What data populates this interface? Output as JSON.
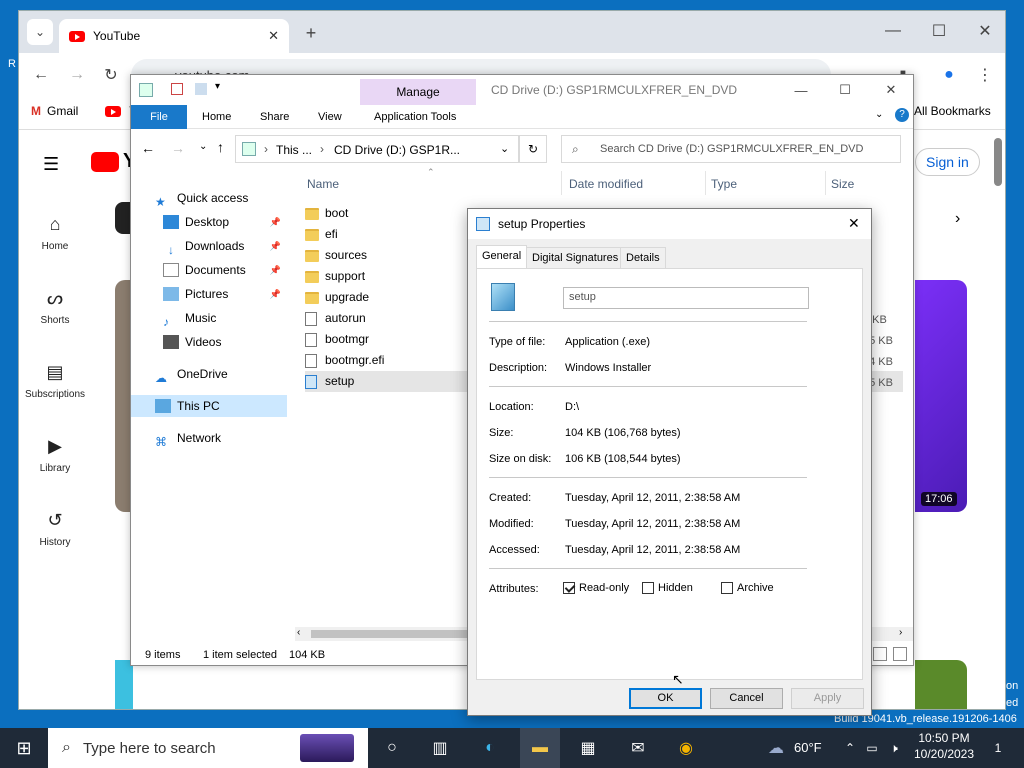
{
  "desktop": {
    "left_text": "R",
    "right_text_1": "on",
    "right_text_2": "ed",
    "build": "Build 19041.vb_release.191206-1406"
  },
  "chrome": {
    "tab_title": "YouTube",
    "tab_close": "✕",
    "new_tab": "+",
    "url": "youtube.com",
    "bookmarks": [
      {
        "label": "Gmail"
      },
      {
        "label": "Y"
      }
    ],
    "all_bookmarks": "All Bookmarks",
    "youtube": {
      "logo_text": "Y",
      "sign_in": "Sign in",
      "sidebar": [
        {
          "label": "Home",
          "icon": "home-icon"
        },
        {
          "label": "Shorts",
          "icon": "shorts-icon"
        },
        {
          "label": "Subscriptions",
          "icon": "subscriptions-icon"
        },
        {
          "label": "Library",
          "icon": "library-icon"
        },
        {
          "label": "History",
          "icon": "history-icon"
        }
      ],
      "video_duration": "17:06"
    }
  },
  "explorer": {
    "title": "CD Drive (D:) GSP1RMCULXFRER_EN_DVD",
    "manage_label": "Manage",
    "ribbon_tabs": [
      "File",
      "Home",
      "Share",
      "View",
      "Application Tools"
    ],
    "breadcrumb": [
      "This ...",
      "CD Drive (D:) GSP1R..."
    ],
    "search_placeholder": "Search CD Drive (D:) GSP1RMCULXFRER_EN_DVD",
    "columns": [
      "Name",
      "Date modified",
      "Type",
      "Size"
    ],
    "nav": {
      "quick_access": "Quick access",
      "items": [
        {
          "label": "Desktop",
          "pinned": true
        },
        {
          "label": "Downloads",
          "pinned": true
        },
        {
          "label": "Documents",
          "pinned": true
        },
        {
          "label": "Pictures",
          "pinned": true
        },
        {
          "label": "Music",
          "pinned": false
        },
        {
          "label": "Videos",
          "pinned": false
        }
      ],
      "onedrive": "OneDrive",
      "this_pc": "This PC",
      "network": "Network"
    },
    "files": [
      {
        "name": "boot",
        "kind": "folder",
        "size": ""
      },
      {
        "name": "efi",
        "kind": "folder",
        "size": ""
      },
      {
        "name": "sources",
        "kind": "folder",
        "size": ""
      },
      {
        "name": "support",
        "kind": "folder",
        "size": ""
      },
      {
        "name": "upgrade",
        "kind": "folder",
        "size": ""
      },
      {
        "name": "autorun",
        "kind": "file",
        "size": "1 KB"
      },
      {
        "name": "bootmgr",
        "kind": "file",
        "size": "75 KB"
      },
      {
        "name": "bootmgr.efi",
        "kind": "file",
        "size": "54 KB"
      },
      {
        "name": "setup",
        "kind": "app",
        "size": "05 KB",
        "selected": true
      }
    ],
    "status": {
      "items": "9 items",
      "selected": "1 item selected",
      "size": "104 KB"
    }
  },
  "dialog": {
    "title": "setup Properties",
    "tabs": [
      "General",
      "Digital Signatures",
      "Details"
    ],
    "name_value": "setup",
    "fields": [
      {
        "label": "Type of file:",
        "value": "Application (.exe)"
      },
      {
        "label": "Description:",
        "value": "Windows Installer"
      },
      {
        "label": "Location:",
        "value": "D:\\"
      },
      {
        "label": "Size:",
        "value": "104 KB (106,768 bytes)"
      },
      {
        "label": "Size on disk:",
        "value": "106 KB (108,544 bytes)"
      },
      {
        "label": "Created:",
        "value": "Tuesday, April 12, 2011, 2:38:58 AM"
      },
      {
        "label": "Modified:",
        "value": "Tuesday, April 12, 2011, 2:38:58 AM"
      },
      {
        "label": "Accessed:",
        "value": "Tuesday, April 12, 2011, 2:38:58 AM"
      }
    ],
    "attributes_label": "Attributes:",
    "attributes": [
      {
        "label": "Read-only",
        "checked": true
      },
      {
        "label": "Hidden",
        "checked": false
      },
      {
        "label": "Archive",
        "checked": false
      }
    ],
    "buttons": {
      "ok": "OK",
      "cancel": "Cancel",
      "apply": "Apply"
    }
  },
  "taskbar": {
    "search_placeholder": "Type here to search",
    "weather": "60°F",
    "time": "10:50 PM",
    "date": "10/20/2023",
    "notification_count": "1"
  }
}
